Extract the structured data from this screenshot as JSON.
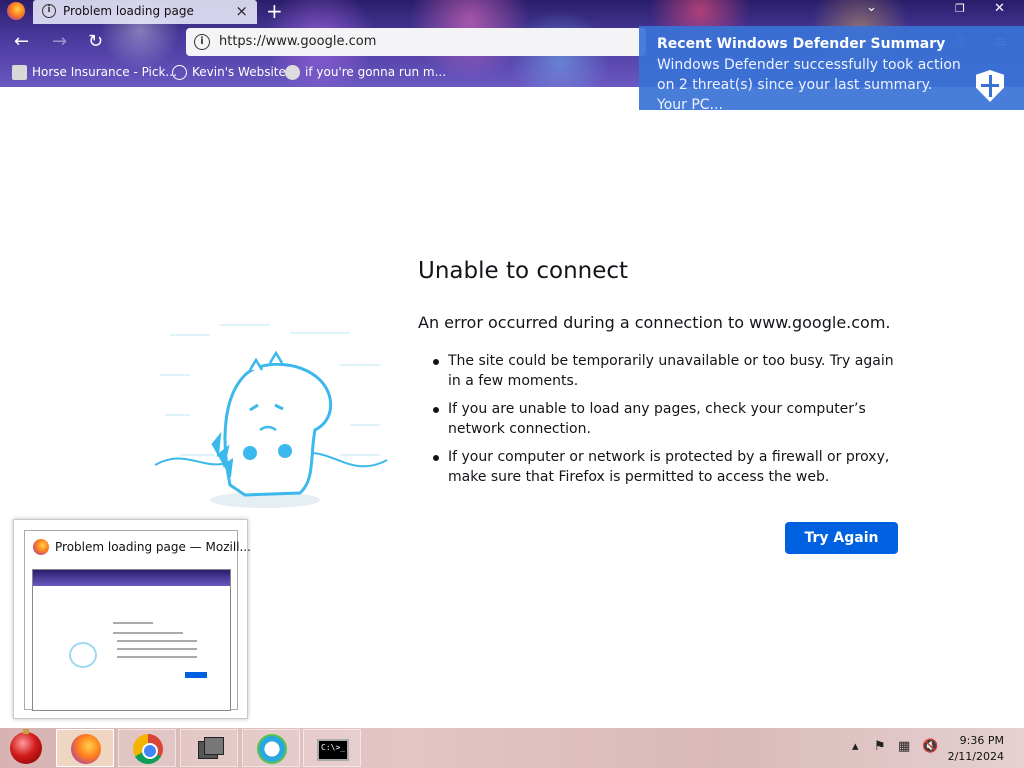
{
  "browser": {
    "tab": {
      "title": "Problem loading page"
    },
    "url": "https://www.google.com",
    "bookmarks": [
      {
        "label": "Horse Insurance - Pick..."
      },
      {
        "label": "Kevin's Website"
      },
      {
        "label": "if you're gonna run m..."
      }
    ]
  },
  "notification": {
    "title": "Recent Windows Defender Summary",
    "body": "Windows Defender successfully took action on 2 threat(s) since your last summary. Your PC..."
  },
  "error_page": {
    "title": "Unable to connect",
    "description": "An error occurred during a connection to www.google.com.",
    "bullets": [
      "The site could be temporarily unavailable or too busy. Try again in a few moments.",
      "If you are unable to load any pages, check your computer’s network connection.",
      "If your computer or network is protected by a firewall or proxy, make sure that Firefox is permitted to access the web."
    ],
    "try_again_label": "Try Again"
  },
  "taskbar_preview": {
    "title": "Problem loading page — Mozill..."
  },
  "taskbar": {
    "apps": [
      "firefox-icon",
      "chrome-icon",
      "task-view-icon",
      "edge-icon",
      "cmd-icon"
    ],
    "cmd_text": "C:\\>_",
    "time": "9:36 PM",
    "date": "2/11/2024"
  }
}
